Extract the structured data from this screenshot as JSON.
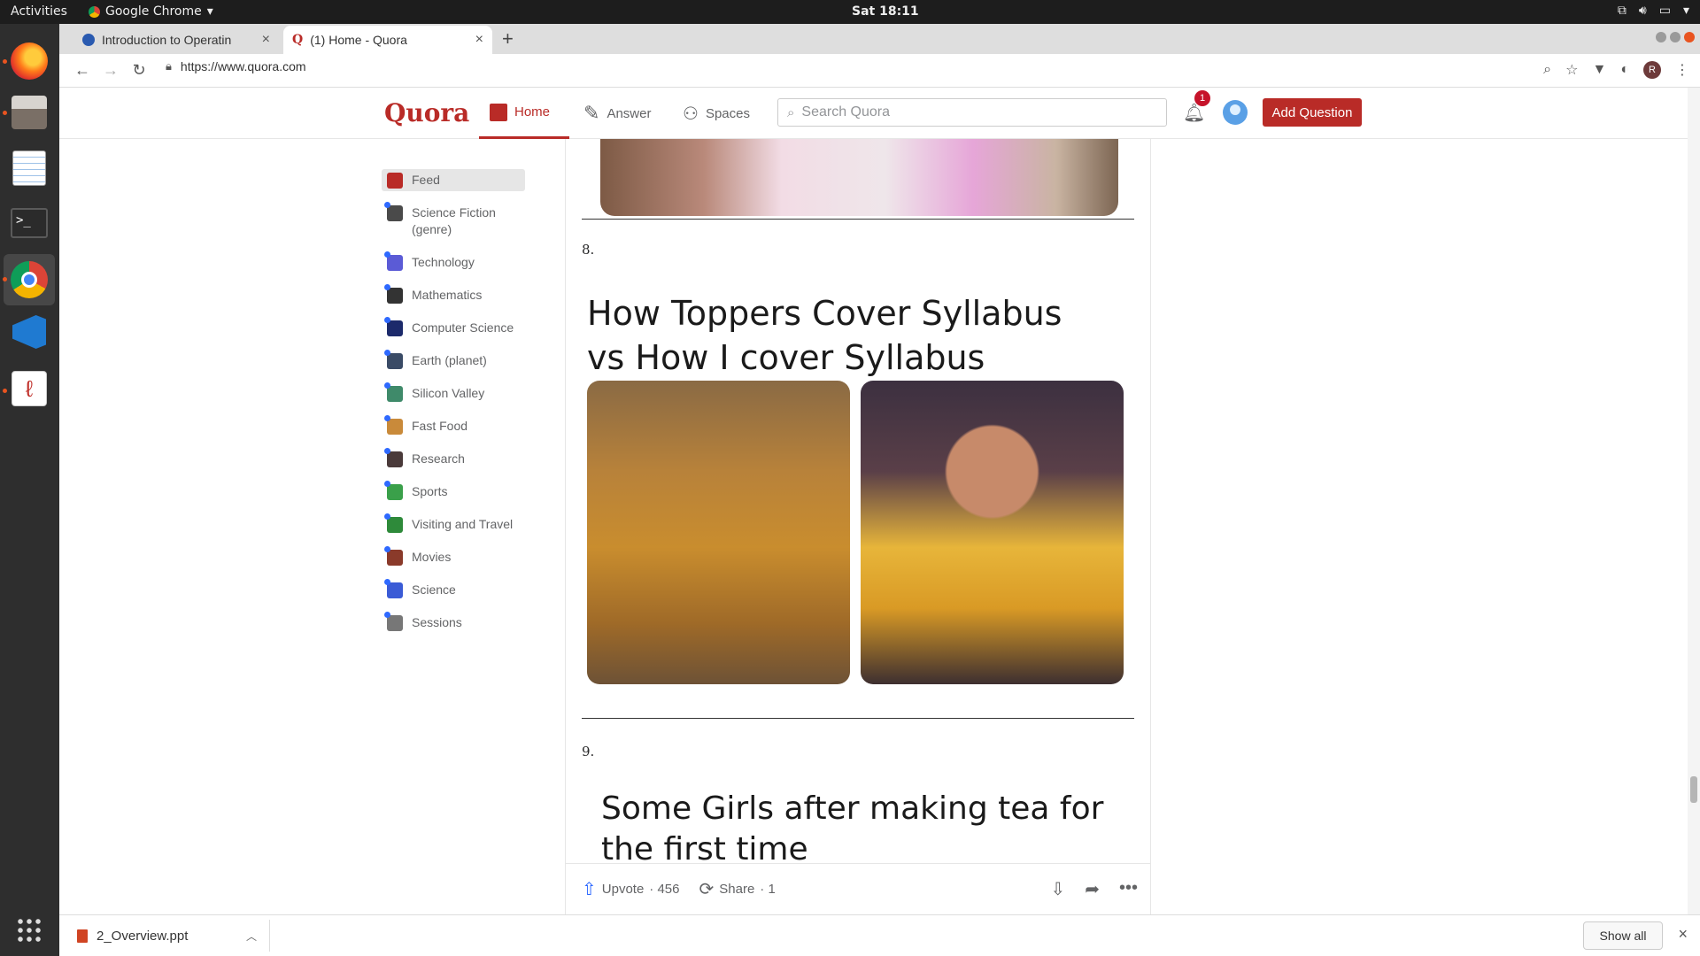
{
  "system": {
    "activities": "Activities",
    "app_name": "Google Chrome",
    "clock": "Sat 18:11"
  },
  "dock": {
    "items": [
      "firefox-icon",
      "files-icon",
      "text-editor-icon",
      "terminal-icon",
      "chrome-icon",
      "vscode-icon",
      "pdf-viewer-icon"
    ],
    "apps_grid": "show-applications-icon"
  },
  "browser": {
    "tabs": [
      {
        "title": "Introduction to Operatin",
        "active": false
      },
      {
        "title": "(1) Home - Quora",
        "active": true
      }
    ],
    "url": "https://www.quora.com",
    "profile_initial": "R"
  },
  "quora": {
    "logo": "Quora",
    "nav": {
      "home": "Home",
      "answer": "Answer",
      "spaces": "Spaces"
    },
    "search_placeholder": "Search Quora",
    "notification_count": "1",
    "add_question": "Add Question",
    "sidebar": [
      {
        "label": "Feed",
        "active": true,
        "color": "#b92b27"
      },
      {
        "label": "Science Fiction (genre)",
        "color": "#4a4a4a"
      },
      {
        "label": "Technology",
        "color": "#5b5bd6"
      },
      {
        "label": "Mathematics",
        "color": "#333333"
      },
      {
        "label": "Computer Science",
        "color": "#1c2a6b"
      },
      {
        "label": "Earth (planet)",
        "color": "#3a4b66"
      },
      {
        "label": "Silicon Valley",
        "color": "#3f8a6a"
      },
      {
        "label": "Fast Food",
        "color": "#c98a3a"
      },
      {
        "label": "Research",
        "color": "#4a3a3a"
      },
      {
        "label": "Sports",
        "color": "#3aa04a"
      },
      {
        "label": "Visiting and Travel",
        "color": "#2e8a3a"
      },
      {
        "label": "Movies",
        "color": "#8a3a2a"
      },
      {
        "label": "Science",
        "color": "#3a5bd6"
      },
      {
        "label": "Sessions",
        "color": "#777777"
      }
    ],
    "feed": {
      "item8_number": "8.",
      "item8_title": "How Toppers Cover Syllabus vs How I cover Syllabus",
      "item9_number": "9.",
      "item9_title": "Some Girls after making tea for the first time"
    },
    "actions": {
      "upvote_label": "Upvote",
      "upvote_count": "· 456",
      "share_label": "Share",
      "share_count": "· 1"
    }
  },
  "downloads": {
    "file": "2_Overview.ppt",
    "show_all": "Show all"
  }
}
